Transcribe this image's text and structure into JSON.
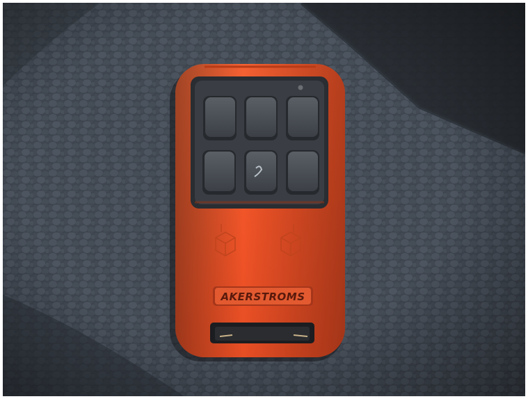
{
  "photo": {
    "subject_icon": "remote-control-icon",
    "brand_label": "AKERSTROMS",
    "button_count": 6,
    "colors": {
      "remote_body": "#f2572b",
      "remote_shadow": "#c43e18",
      "keypad_panel": "#3a3d42",
      "key": "#4a4e54",
      "label_plate": "#d64825",
      "seat_fabric": "#3d444d",
      "dark_corner": "#1d2024"
    }
  }
}
